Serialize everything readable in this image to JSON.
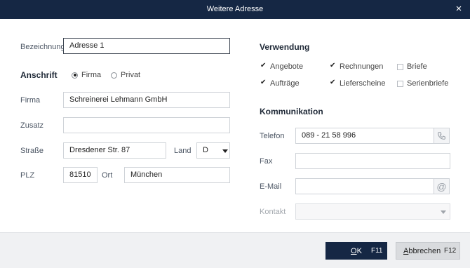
{
  "window": {
    "title": "Weitere Adresse",
    "close_glyph": "×"
  },
  "left": {
    "bezeichnung": {
      "label": "Bezeichnung",
      "value": "Adresse 1"
    },
    "anschrift": {
      "heading": "Anschrift",
      "options": [
        {
          "label": "Firma",
          "selected": true
        },
        {
          "label": "Privat",
          "selected": false
        }
      ]
    },
    "firma": {
      "label": "Firma",
      "value": "Schreinerei Lehmann GmbH"
    },
    "zusatz": {
      "label": "Zusatz",
      "value": ""
    },
    "strasse": {
      "label": "Straße",
      "value": "Dresdener Str. 87"
    },
    "land": {
      "label": "Land",
      "value": "D"
    },
    "plz": {
      "label": "PLZ",
      "value": "81510"
    },
    "ort": {
      "label": "Ort",
      "value": "München"
    }
  },
  "right": {
    "verwendung": {
      "heading": "Verwendung",
      "items": [
        {
          "label": "Angebote",
          "checked": true
        },
        {
          "label": "Rechnungen",
          "checked": true
        },
        {
          "label": "Briefe",
          "checked": false
        },
        {
          "label": "Aufträge",
          "checked": true
        },
        {
          "label": "Lieferscheine",
          "checked": true
        },
        {
          "label": "Serienbriefe",
          "checked": false
        }
      ]
    },
    "kommunikation": {
      "heading": "Kommunikation",
      "telefon": {
        "label": "Telefon",
        "value": "089 - 21 58 996",
        "icon": "phone-icon"
      },
      "fax": {
        "label": "Fax",
        "value": ""
      },
      "email": {
        "label": "E-Mail",
        "value": "",
        "icon": "at-icon",
        "icon_glyph": "@"
      },
      "kontakt": {
        "label": "Kontakt",
        "value": ""
      }
    }
  },
  "footer": {
    "ok": {
      "mnemonic": "O",
      "rest": "K",
      "key": "F11"
    },
    "cancel": {
      "mnemonic": "A",
      "rest": "bbrechen",
      "key": "F12"
    }
  },
  "colors": {
    "titlebar": "#152744",
    "ok_button": "#152744",
    "footer": "#f0f1f3"
  }
}
